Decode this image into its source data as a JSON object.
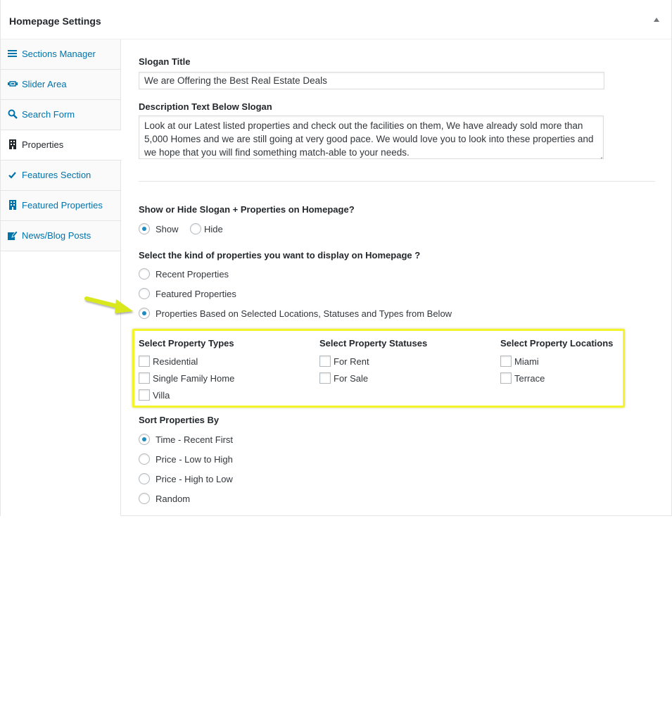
{
  "panel": {
    "title": "Homepage Settings"
  },
  "sidebar": {
    "items": [
      {
        "label": "Sections Manager",
        "icon": "menu-lines-icon",
        "active": false
      },
      {
        "label": "Slider Area",
        "icon": "slides-icon",
        "active": false
      },
      {
        "label": "Search Form",
        "icon": "search-icon",
        "active": false
      },
      {
        "label": "Properties",
        "icon": "building-icon",
        "active": true
      },
      {
        "label": "Features Section",
        "icon": "checkmark-icon",
        "active": false
      },
      {
        "label": "Featured Properties",
        "icon": "building-icon",
        "active": false
      },
      {
        "label": "News/Blog Posts",
        "icon": "edit-post-icon",
        "active": false
      }
    ]
  },
  "form": {
    "slogan_title": {
      "label": "Slogan Title",
      "value": "We are Offering the Best Real Estate Deals"
    },
    "description": {
      "label": "Description Text Below Slogan",
      "value": "Look at our Latest listed properties and check out the facilities on them, We have already sold more than 5,000 Homes and we are still going at very good pace. We would love you to look into these properties and we hope that you will find something match-able to your needs."
    },
    "show_hide": {
      "label": "Show or Hide Slogan + Properties on Homepage?",
      "options": [
        {
          "label": "Show",
          "checked": true
        },
        {
          "label": "Hide",
          "checked": false
        }
      ]
    },
    "kind": {
      "label": "Select the kind of properties you want to display on Homepage ?",
      "options": [
        {
          "label": "Recent Properties",
          "checked": false
        },
        {
          "label": "Featured Properties",
          "checked": false
        },
        {
          "label": "Properties Based on Selected Locations, Statuses and Types from Below",
          "checked": true
        }
      ]
    },
    "types": {
      "label": "Select Property Types",
      "options": [
        {
          "label": "Residential",
          "checked": false
        },
        {
          "label": "Single Family Home",
          "checked": false
        },
        {
          "label": "Villa",
          "checked": false
        }
      ]
    },
    "statuses": {
      "label": "Select Property Statuses",
      "options": [
        {
          "label": "For Rent",
          "checked": false
        },
        {
          "label": "For Sale",
          "checked": false
        }
      ]
    },
    "locations": {
      "label": "Select Property Locations",
      "options": [
        {
          "label": "Miami",
          "checked": false
        },
        {
          "label": "Terrace",
          "checked": false
        }
      ]
    },
    "sort": {
      "label": "Sort Properties By",
      "options": [
        {
          "label": "Time - Recent First",
          "checked": true
        },
        {
          "label": "Price - Low to High",
          "checked": false
        },
        {
          "label": "Price - High to Low",
          "checked": false
        },
        {
          "label": "Random",
          "checked": false
        }
      ]
    }
  },
  "colors": {
    "accent": "#0073aa",
    "radio_dot": "#1e8cbe",
    "highlight": "#f4f42a",
    "arrow": "#d8e81c"
  }
}
